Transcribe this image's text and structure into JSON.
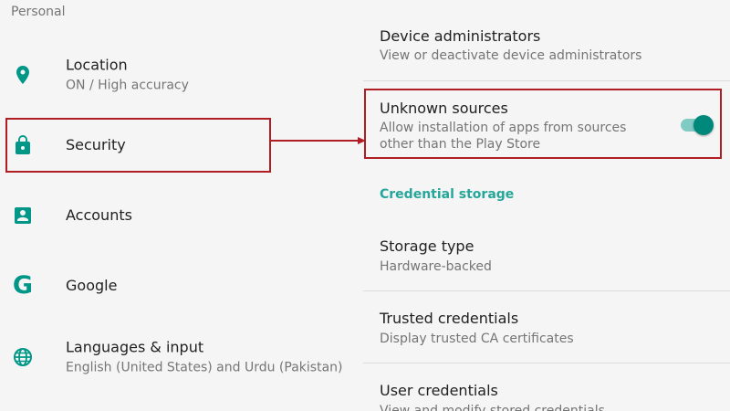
{
  "left_panel": {
    "section_header": "Personal",
    "items": [
      {
        "name": "location",
        "icon": "location-pin-icon",
        "title": "Location",
        "summary": "ON / High accuracy"
      },
      {
        "name": "security",
        "icon": "lock-icon",
        "title": "Security",
        "summary": ""
      },
      {
        "name": "accounts",
        "icon": "account-box-icon",
        "title": "Accounts",
        "summary": ""
      },
      {
        "name": "google",
        "icon": "google-icon",
        "title": "Google",
        "summary": ""
      },
      {
        "name": "languages",
        "icon": "globe-icon",
        "title": "Languages & input",
        "summary": "English (United States) and Urdu (Pakistan)"
      }
    ]
  },
  "right_panel": {
    "device_admins": {
      "title": "Device administrators",
      "summary": "View or deactivate device administrators"
    },
    "unknown_sources": {
      "title": "Unknown sources",
      "summary": "Allow installation of apps from sources other than the Play Store",
      "enabled": true
    },
    "credential_category": "Credential storage",
    "storage_type": {
      "title": "Storage type",
      "summary": "Hardware-backed"
    },
    "trusted_credentials": {
      "title": "Trusted credentials",
      "summary": "Display trusted CA certificates"
    },
    "user_credentials": {
      "title": "User credentials",
      "summary": "View and modify stored credentials"
    }
  },
  "colors": {
    "accent": "#26a69a",
    "toggle_thumb": "#00897b",
    "toggle_track": "#80cbc4",
    "highlight": "#b01e23",
    "background": "#f5f5f5"
  }
}
